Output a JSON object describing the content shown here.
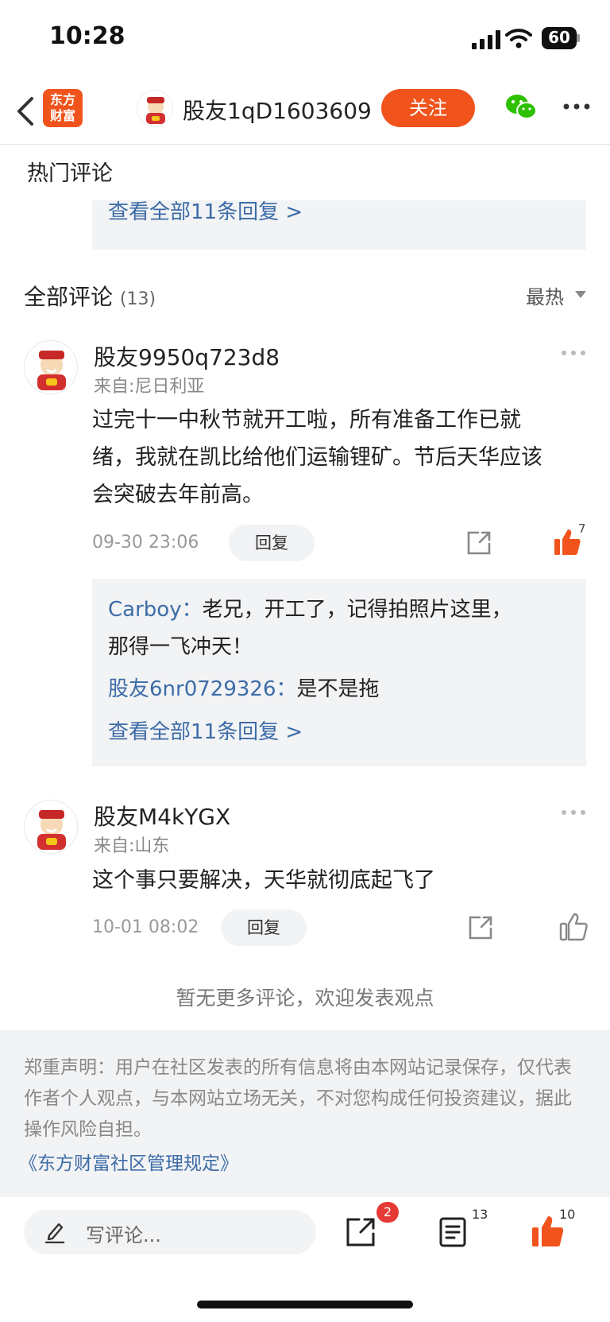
{
  "status_bar": {
    "time": "10:28",
    "battery": "60"
  },
  "header": {
    "logo_line1": "东方",
    "logo_line2": "财富",
    "username": "股友1qD1603609",
    "follow_label": "关注"
  },
  "hot_section": {
    "title": "热门评论",
    "view_all": "查看全部11条回复 >"
  },
  "all_section": {
    "title": "全部评论",
    "count": "(13)",
    "sort_label": "最热"
  },
  "comments": [
    {
      "username": "股友9950q723d8",
      "from": "来自:尼日利亚",
      "content_lines": [
        "过完十一中秋节就开工啦，所有准备工作已就",
        "绪，我就在凯比给他们运输锂矿。节后天华应该",
        "会突破去年前高。"
      ],
      "time": "09-30 23:06",
      "reply_label": "回复",
      "likes": "7",
      "replies": [
        {
          "name": "Carboy",
          "sep": "：",
          "text_line1": "老兄，开工了，记得拍照片这里，",
          "text_line2": "那得一飞冲天！"
        },
        {
          "name": "股友6nr0729326",
          "sep": "：",
          "text_line1": "是不是拖"
        }
      ],
      "view_all": "查看全部11条回复 >"
    },
    {
      "username": "股友M4kYGX",
      "from": "来自:山东",
      "content_lines": [
        "这个事只要解决，天华就彻底起飞了"
      ],
      "time": "10-01 08:02",
      "reply_label": "回复"
    }
  ],
  "no_more": "暂无更多评论，欢迎发表观点",
  "notice": {
    "text": "郑重声明：用户在社区发表的所有信息将由本网站记录保存，仅代表作者个人观点，与本网站立场无关，不对您构成任何投资建议，据此操作风险自担。",
    "link": "《东方财富社区管理规定》"
  },
  "bottom_bar": {
    "placeholder": "写评论...",
    "share_badge": "2",
    "comment_count": "13",
    "like_count": "10"
  },
  "colors": {
    "brand": "#f0541c",
    "link": "#3d6ca8",
    "badge": "#e53935"
  }
}
